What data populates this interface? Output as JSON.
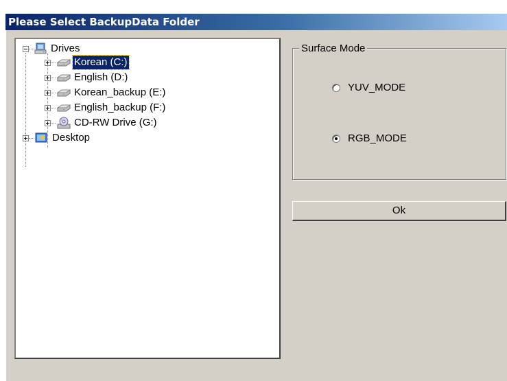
{
  "window": {
    "title": "Please Select BackupData Folder"
  },
  "tree": {
    "root": {
      "label": "Drives",
      "icon": "drives-icon",
      "expanded": true
    },
    "drives": [
      {
        "label": "Korean (C:)",
        "icon": "hard-drive-icon",
        "selected": true
      },
      {
        "label": "English (D:)",
        "icon": "hard-drive-icon",
        "selected": false
      },
      {
        "label": "Korean_backup (E:)",
        "icon": "hard-drive-icon",
        "selected": false
      },
      {
        "label": "English_backup (F:)",
        "icon": "hard-drive-icon",
        "selected": false
      },
      {
        "label": "CD-RW Drive (G:)",
        "icon": "cd-drive-icon",
        "selected": false
      }
    ],
    "desktop": {
      "label": "Desktop",
      "icon": "desktop-icon",
      "expanded": false
    }
  },
  "surface_mode": {
    "legend": "Surface Mode",
    "options": [
      {
        "label": "YUV_MODE",
        "checked": false
      },
      {
        "label": "RGB_MODE",
        "checked": true
      }
    ]
  },
  "ok_button": {
    "label": "Ok"
  },
  "colors": {
    "titlebar_start": "#0a246a",
    "titlebar_end": "#a6caf0",
    "dialog_bg": "#d4d0c8",
    "selection": "#0a246a"
  }
}
